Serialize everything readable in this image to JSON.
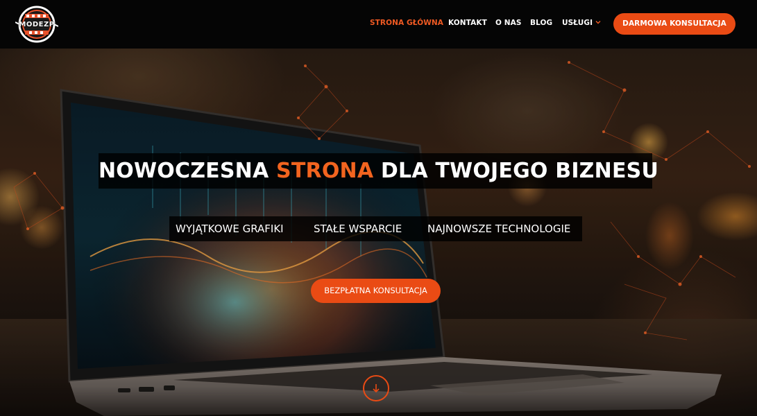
{
  "header": {
    "logo_text": "MODEZP",
    "nav": [
      {
        "label": "STRONA GŁÓWNA",
        "active": true
      },
      {
        "label": "KONTAKT"
      },
      {
        "label": "O NAS"
      },
      {
        "label": "BLOG"
      },
      {
        "label": "USŁUGI"
      }
    ],
    "dropdown_icon": "chevron-down-icon",
    "cta_label": "DARMOWA KONSULTACJA"
  },
  "hero": {
    "headline_part1": "NOWOCZESNA ",
    "headline_accent": "STRONA",
    "headline_part2": " DLA TWOJEGO BIZNESU",
    "features": [
      "WYJĄTKOWE GRAFIKI",
      "STAŁE WSPARCIE",
      "NAJNOWSZE TECHNOLOGIE"
    ],
    "cta_label": "BEZPŁATNA KONSULTACJA",
    "scroll_icon": "arrow-down-icon"
  },
  "colors": {
    "accent": "#ea4b14",
    "active_nav": "#f05a23",
    "header_bg": "#050505"
  }
}
